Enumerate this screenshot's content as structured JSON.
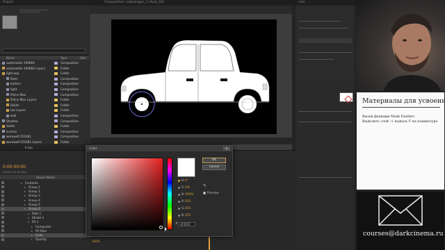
{
  "titlebar": {
    "left": "Project",
    "mid": "Composition: volkswagen_1 (Auto_01)",
    "right": "Info"
  },
  "project": {
    "columns": [
      "Name",
      "Type",
      "Size"
    ],
    "items": [
      {
        "name": "automobile 194864",
        "type": "Composition",
        "color": "#b9a9d6",
        "indent": 0
      },
      {
        "name": "automobile 194864 Layers",
        "type": "Folder",
        "color": "#e5c25b",
        "indent": 0
      },
      {
        "name": "light.aep",
        "type": "Folder",
        "color": "#e5c25b",
        "indent": 0
      },
      {
        "name": "flash",
        "type": "Composition",
        "color": "#b9a9d6",
        "indent": 1
      },
      {
        "name": "lantern",
        "type": "Composition",
        "color": "#b9a9d6",
        "indent": 1
      },
      {
        "name": "light",
        "type": "Composition",
        "color": "#b9a9d6",
        "indent": 1
      },
      {
        "name": "Police Man",
        "type": "Composition",
        "color": "#b9a9d6",
        "indent": 1
      },
      {
        "name": "Police Man Layers",
        "type": "Folder",
        "color": "#e5c25b",
        "indent": 1
      },
      {
        "name": "Solids",
        "type": "Folder",
        "color": "#e5c25b",
        "indent": 1
      },
      {
        "name": "tue Layers",
        "type": "Folder",
        "color": "#e5c25b",
        "indent": 1
      },
      {
        "name": "wall",
        "type": "Composition",
        "color": "#b9a9d6",
        "indent": 1
      },
      {
        "name": "Shadow",
        "type": "Composition",
        "color": "#b9a9d6",
        "indent": 0
      },
      {
        "name": "Solids",
        "type": "Folder",
        "color": "#e5c25b",
        "indent": 0
      },
      {
        "name": "sunrise",
        "type": "Composition",
        "color": "#b9a9d6",
        "indent": 0
      },
      {
        "name": "werewolf-151661",
        "type": "Composition",
        "color": "#b9a9d6",
        "indent": 0
      },
      {
        "name": "werewolf-151661 Layers",
        "type": "Folder",
        "color": "#e5c25b",
        "indent": 0
      }
    ],
    "bpc": "8 bpc"
  },
  "timeline": {
    "timecode": "0:00:00:00",
    "fps": "00000 (25.00 fps)",
    "column": "Source Name",
    "rows": [
      {
        "label": "Contents",
        "indent": 2
      },
      {
        "label": "Group 1",
        "indent": 3
      },
      {
        "label": "Group 2",
        "indent": 3
      },
      {
        "label": "Group 3",
        "indent": 3
      },
      {
        "label": "Group 4",
        "indent": 3
      },
      {
        "label": "Group 5",
        "indent": 3
      },
      {
        "label": "Group 6",
        "indent": 3,
        "selected": true
      },
      {
        "label": "Path 1",
        "indent": 4
      },
      {
        "label": "Stroke 1",
        "indent": 4
      },
      {
        "label": "Fill 1",
        "indent": 4
      },
      {
        "label": "Composite",
        "indent": 5
      },
      {
        "label": "Fill Rule",
        "indent": 5
      },
      {
        "label": "Color",
        "indent": 5,
        "selected": true
      },
      {
        "label": "Opacity",
        "indent": 5
      }
    ],
    "opacity_value": "100%"
  },
  "color_dialog": {
    "title": "Color",
    "ok_label": "OK",
    "cancel_label": "Cancel",
    "preview_label": "Preview",
    "hex_value": "FFFFFF",
    "channels": [
      {
        "label": "H:",
        "value": "0°",
        "checked": true
      },
      {
        "label": "S:",
        "value": "0%"
      },
      {
        "label": "B:",
        "value": "100%"
      },
      {
        "label": "R:",
        "value": "255"
      },
      {
        "label": "G:",
        "value": "255"
      },
      {
        "label": "B:",
        "value": "255"
      }
    ]
  },
  "sidebar": {
    "title": "Материалы для усвоения:",
    "lines": [
      "Вызов функции Mask Feather:",
      "Выделить слой -> нажать F на клавиатуре"
    ],
    "email": "courses@darkcinema.ru"
  }
}
